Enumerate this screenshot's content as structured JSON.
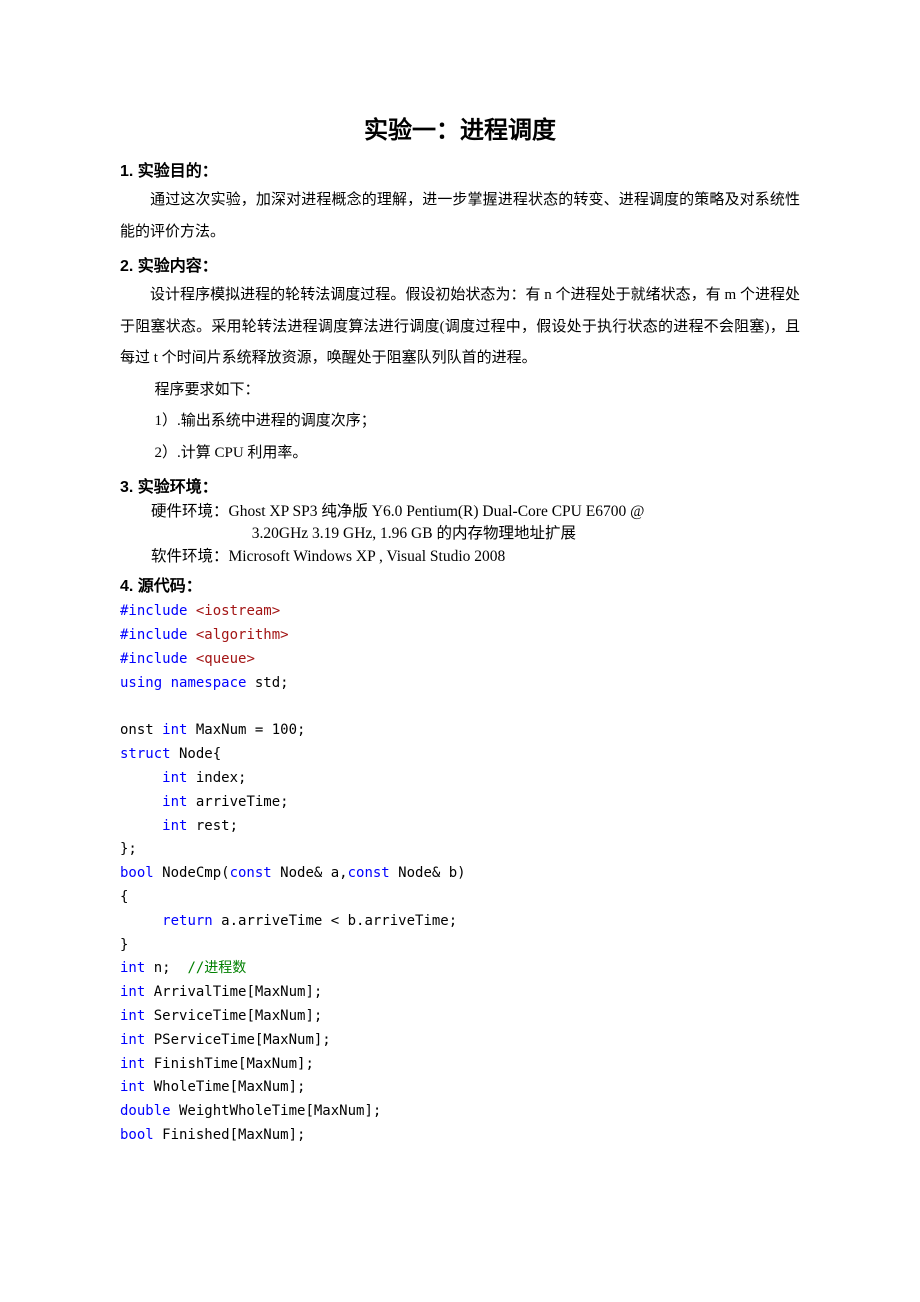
{
  "title": "实验一：进程调度",
  "s1": {
    "head": "1. 实验目的：",
    "p1": "通过这次实验，加深对进程概念的理解，进一步掌握进程状态的转变、进程调度的策略及对系统性能的评价方法。"
  },
  "s2": {
    "head": "2. 实验内容：",
    "p1": "设计程序模拟进程的轮转法调度过程。假设初始状态为：有 n 个进程处于就绪状态，有 m 个进程处于阻塞状态。采用轮转法进程调度算法进行调度(调度过程中，假设处于执行状态的进程不会阻塞)，且每过 t 个时间片系统释放资源，唤醒处于阻塞队列队首的进程。",
    "p2": "程序要求如下：",
    "li1": "1）.输出系统中进程的调度次序；",
    "li2": "2）.计算 CPU 利用率。"
  },
  "s3": {
    "head": "3. 实验环境：",
    "hw1": "硬件环境：Ghost XP SP3  纯净版  Y6.0    Pentium(R) Dual-Core CPU E6700 @",
    "hw2": "3.20GHz 3.19 GHz, 1.96 GB  的内存物理地址扩展",
    "sw": "软件环境：Microsoft Windows XP , Visual Studio 2008"
  },
  "s4": {
    "head": "4. 源代码：",
    "code": {
      "include": "#include",
      "iostream": " <iostream>",
      "algorithm": " <algorithm>",
      "queue": " <queue>",
      "using": "using",
      "namespace": "namespace",
      "std": " std;",
      "onst": "onst ",
      "int": "int",
      "maxnum": " MaxNum = 100;",
      "struct": "struct",
      "node": " Node{",
      "idx": " index;",
      "arr": " arriveTime;",
      "rest": " rest;",
      "close": "};",
      "bool": "bool",
      "nodecmp": " NodeCmp(",
      "const": "const",
      "nodea": " Node& a,",
      "nodeb": " Node& b)",
      "obrace": "{",
      "return": "return",
      "retline": " a.arriveTime < b.arriveTime;",
      "cbrace": "}",
      "n": " n;  ",
      "cmt": "//进程数",
      "arrival": " ArrivalTime[MaxNum];",
      "service": " ServiceTime[MaxNum];",
      "pservice": " PServiceTime[MaxNum];",
      "finish": " FinishTime[MaxNum];",
      "whole": " WholeTime[MaxNum];",
      "double": "double",
      "weight": " WeightWholeTime[MaxNum];",
      "finished": " Finished[MaxNum];"
    }
  }
}
